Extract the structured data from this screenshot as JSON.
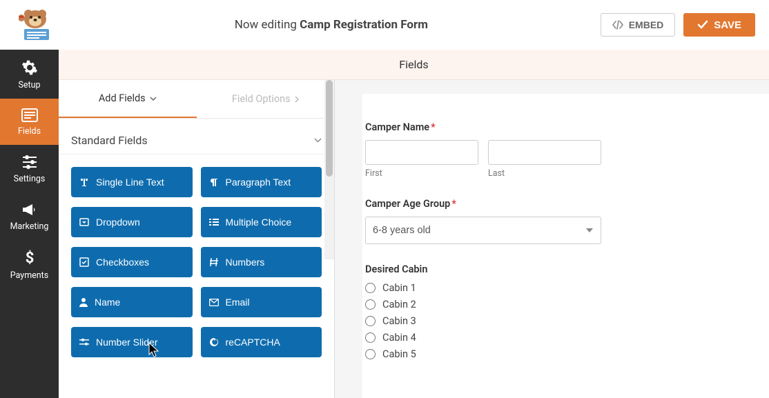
{
  "header": {
    "editing_prefix": "Now editing ",
    "form_name": "Camp Registration Form",
    "embed_label": "EMBED",
    "save_label": "SAVE"
  },
  "sidebar": {
    "items": [
      {
        "label": "Setup"
      },
      {
        "label": "Fields"
      },
      {
        "label": "Settings"
      },
      {
        "label": "Marketing"
      },
      {
        "label": "Payments"
      }
    ]
  },
  "fields_header": "Fields",
  "panel": {
    "add_fields": "Add Fields",
    "field_options": "Field Options",
    "section_title": "Standard Fields",
    "buttons": [
      "Single Line Text",
      "Paragraph Text",
      "Dropdown",
      "Multiple Choice",
      "Checkboxes",
      "Numbers",
      "Name",
      "Email",
      "Number Slider",
      "reCAPTCHA"
    ]
  },
  "form": {
    "camper_name_label": "Camper Name",
    "first_label": "First",
    "last_label": "Last",
    "age_group_label": "Camper Age Group",
    "age_group_value": "6-8 years old",
    "cabin_label": "Desired Cabin",
    "cabins": [
      "Cabin 1",
      "Cabin 2",
      "Cabin 3",
      "Cabin 4",
      "Cabin 5"
    ]
  }
}
